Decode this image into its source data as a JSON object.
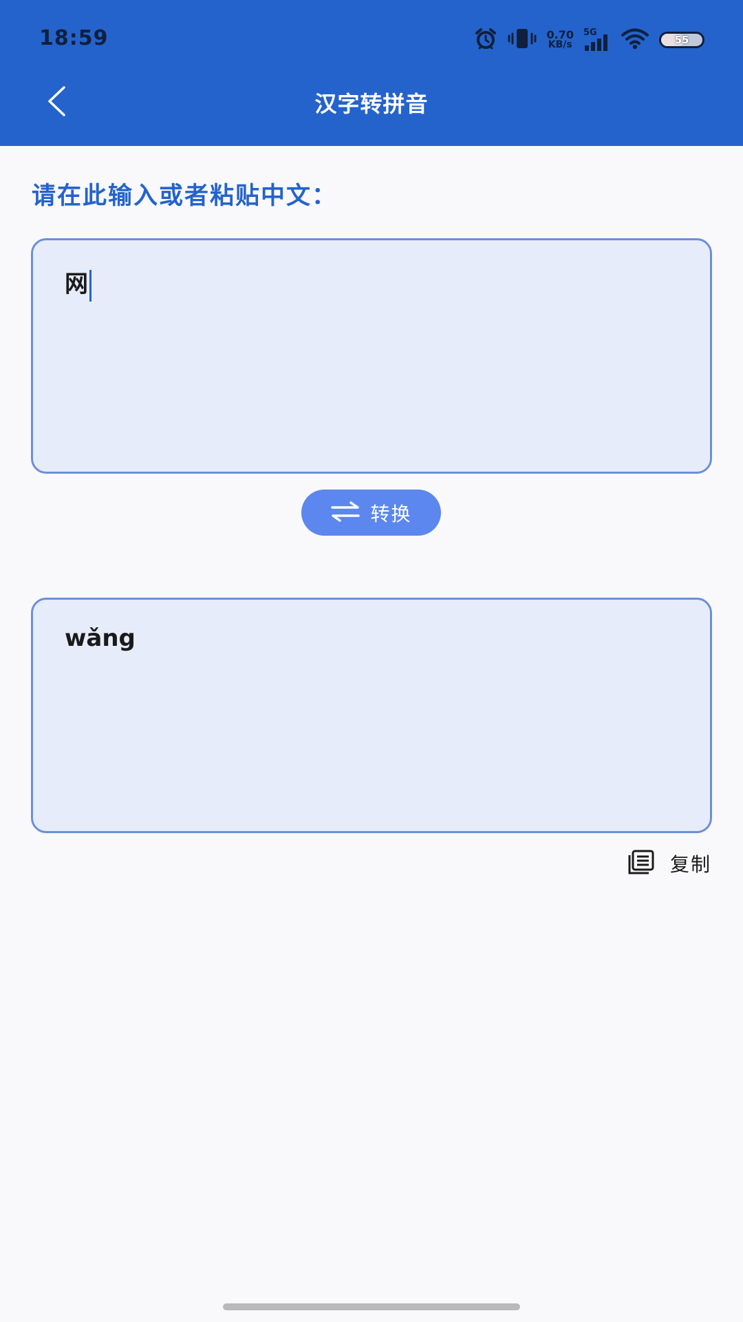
{
  "status_bar": {
    "time": "18:59",
    "net_speed_value": "0.70",
    "net_speed_unit": "KB/s",
    "network_type": "5G",
    "battery_level": "55",
    "icons": [
      "alarm-icon",
      "vibrate-icon",
      "signal-icon",
      "wifi-icon",
      "battery-icon"
    ]
  },
  "header": {
    "title": "汉字转拼音",
    "back_icon": "chevron-left-icon"
  },
  "input_section": {
    "prompt": "请在此输入或者粘贴中文：",
    "value": "网"
  },
  "convert_button": {
    "label": "转换",
    "icon": "swap-arrows-icon"
  },
  "output_section": {
    "value": "wǎng"
  },
  "copy_button": {
    "label": "复制",
    "icon": "copy-icon"
  },
  "colors": {
    "accent": "#2463cb",
    "button": "#5b87ee",
    "textbox_bg": "#e7ecfb",
    "textbox_border": "#6b8fd8",
    "page_bg": "#f9f9fb"
  }
}
